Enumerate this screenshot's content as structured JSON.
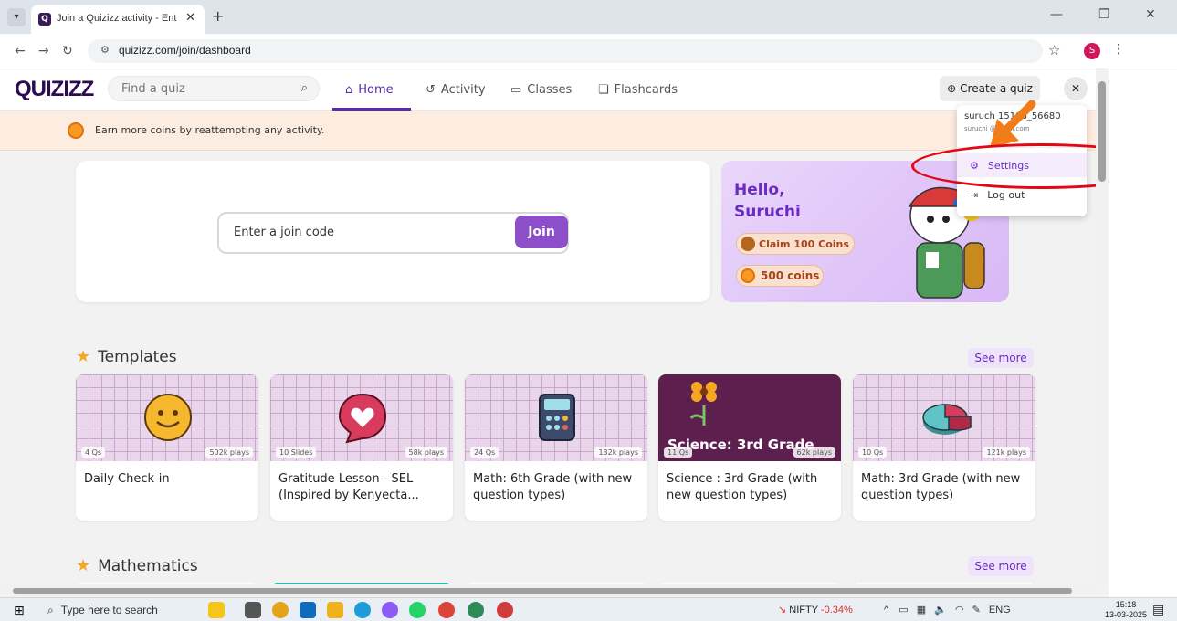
{
  "browser": {
    "tab_title": "Join a Quizizz activity - Enter co",
    "tab_close": "✕",
    "new_tab": "+",
    "url": "quizizz.com/join/dashboard",
    "profile_initial": "S"
  },
  "header": {
    "logo": "QUIZIZZ",
    "search_placeholder": "Find a quiz",
    "nav": [
      {
        "label": "Home",
        "icon": "home-icon",
        "active": true
      },
      {
        "label": "Activity",
        "icon": "history-icon",
        "active": false
      },
      {
        "label": "Classes",
        "icon": "classes-icon",
        "active": false
      },
      {
        "label": "Flashcards",
        "icon": "flashcards-icon",
        "active": false
      }
    ],
    "create_label": "Create a quiz"
  },
  "banner": {
    "text": "Earn more coins by reattempting any activity."
  },
  "join": {
    "placeholder": "Enter a join code",
    "button": "Join"
  },
  "hello": {
    "greeting": "Hello,",
    "name": "Suruchi",
    "claim": "Claim 100 Coins",
    "coins": "500 coins"
  },
  "templates": {
    "title": "Templates",
    "see_more": "See more",
    "cards": [
      {
        "left_badge": "4 Qs",
        "right_badge": "502k plays",
        "title": "Daily Check-in"
      },
      {
        "left_badge": "10 Slides",
        "right_badge": "58k plays",
        "title": "Gratitude Lesson - SEL (Inspired by Kenyecta..."
      },
      {
        "left_badge": "24 Qs",
        "right_badge": "132k plays",
        "title": "Math: 6th Grade (with new question types)"
      },
      {
        "left_badge": "11 Qs",
        "right_badge": "62k plays",
        "title": "Science : 3rd Grade (with new question types)",
        "thumb_text": "Science: 3rd Grade"
      },
      {
        "left_badge": "10 Qs",
        "right_badge": "121k plays",
        "title": "Math: 3rd Grade (with new question types)"
      }
    ]
  },
  "mathematics": {
    "title": "Mathematics",
    "see_more": "See more"
  },
  "dropdown": {
    "name": "suruch      15196_56680",
    "email": "suruchi          @gmail.com",
    "items": [
      {
        "label": "Settings",
        "icon": "gear-icon"
      },
      {
        "label": "Log out",
        "icon": "logout-icon"
      }
    ]
  },
  "taskbar": {
    "search_placeholder": "Type here to search",
    "nifty_label": "NIFTY",
    "nifty_change": "-0.34%",
    "lang": "ENG",
    "time": "15:18",
    "date": "13-03-2025"
  },
  "colors": {
    "brand_purple": "#8d4fc9",
    "nav_active": "#5b2bad",
    "annotation_red": "#e30613",
    "annotation_orange": "#f07d1a"
  }
}
